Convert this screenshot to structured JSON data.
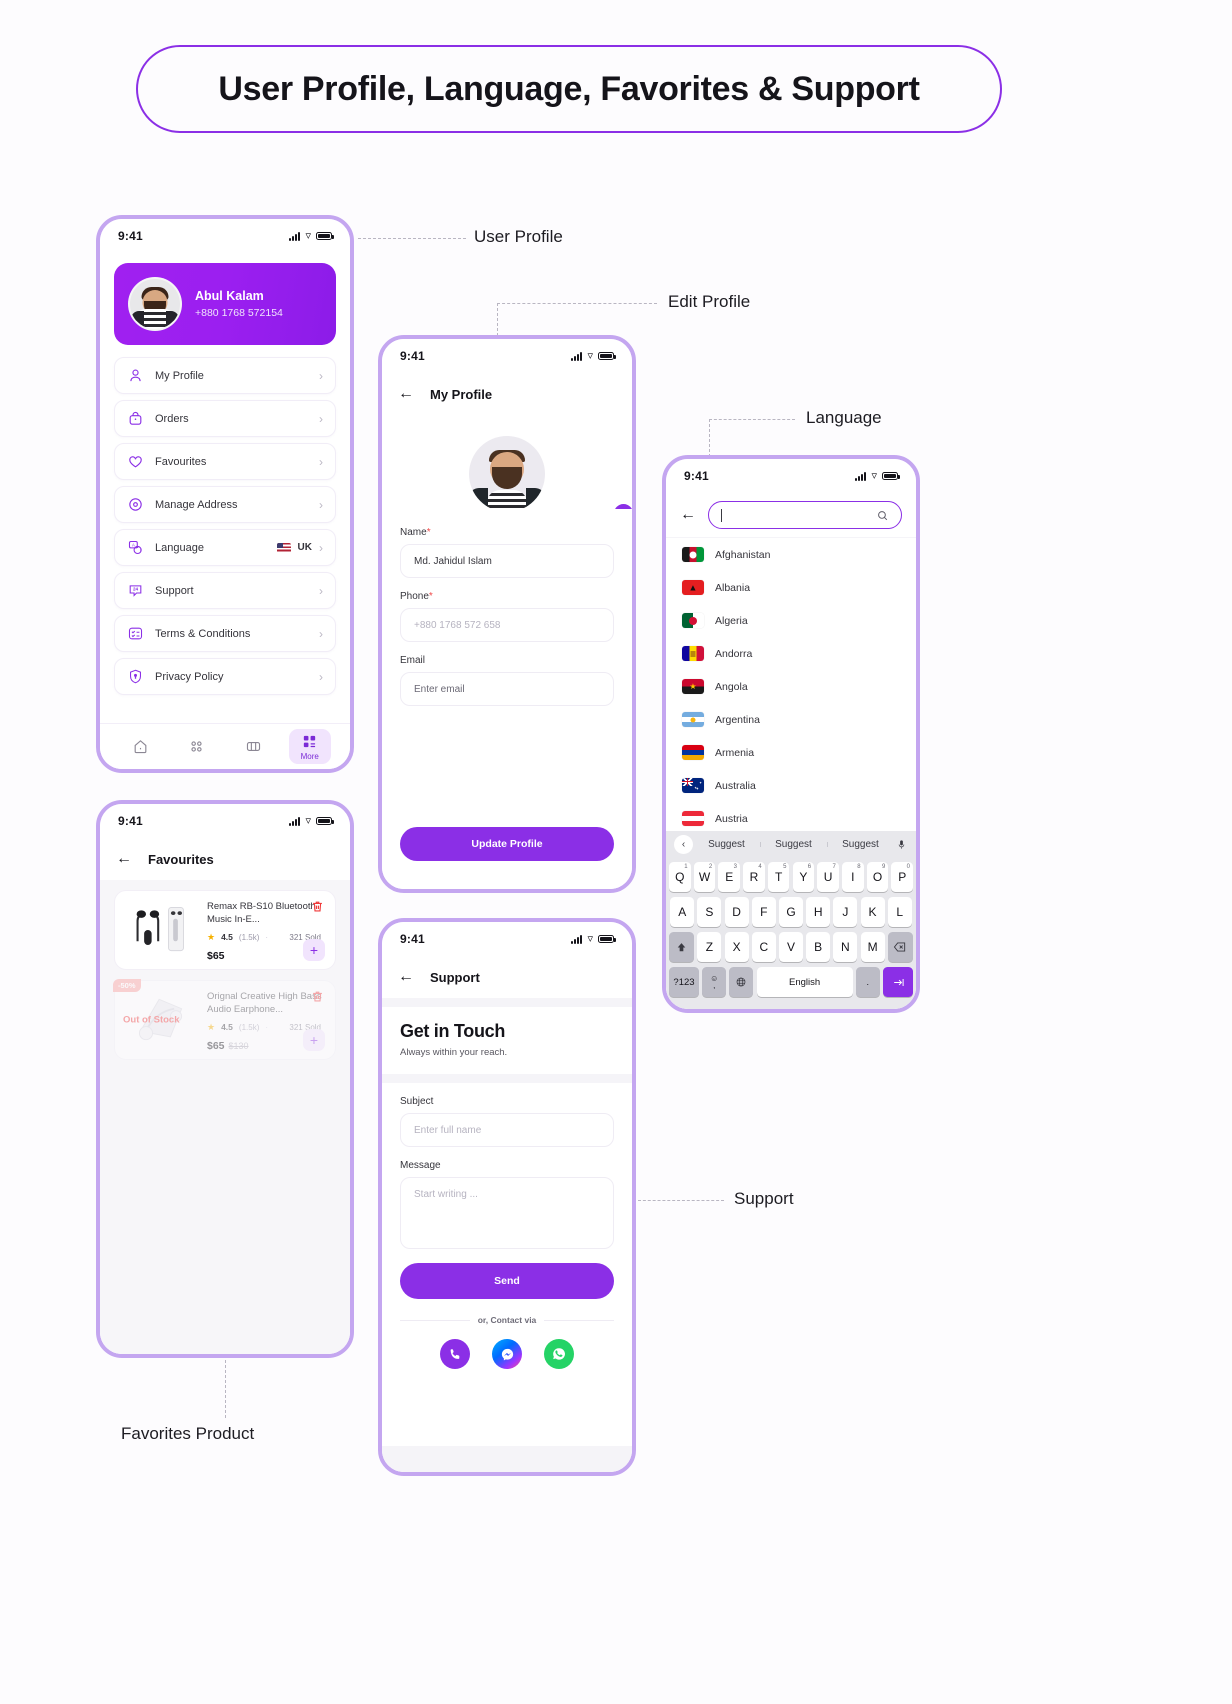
{
  "banner": {
    "title": "User Profile, Language, Favorites & Support"
  },
  "annotations": {
    "user_profile": "User Profile",
    "edit_profile": "Edit Profile",
    "language": "Language",
    "support": "Support",
    "favorites_product": "Favorites Product"
  },
  "status_bar": {
    "time": "9:41"
  },
  "profile_screen": {
    "user": {
      "name": "Abul Kalam",
      "phone": "+880 1768 572154"
    },
    "menu": [
      {
        "label": "My Profile",
        "icon": "user-icon",
        "value": ""
      },
      {
        "label": "Orders",
        "icon": "bag-icon",
        "value": ""
      },
      {
        "label": "Favourites",
        "icon": "heart-icon",
        "value": ""
      },
      {
        "label": "Manage Address",
        "icon": "location-icon",
        "value": ""
      },
      {
        "label": "Language",
        "icon": "translate-icon",
        "value": "UK"
      },
      {
        "label": "Support",
        "icon": "support-24-icon",
        "value": ""
      },
      {
        "label": "Terms & Conditions",
        "icon": "list-check-icon",
        "value": ""
      },
      {
        "label": "Privacy Policy",
        "icon": "shield-icon",
        "value": ""
      }
    ],
    "tabs": [
      {
        "label": "",
        "icon": "home-icon",
        "active": false
      },
      {
        "label": "",
        "icon": "category-icon",
        "active": false
      },
      {
        "label": "",
        "icon": "wallet-icon",
        "active": false
      },
      {
        "label": "More",
        "icon": "grid-icon",
        "active": true
      }
    ]
  },
  "favourites_screen": {
    "title": "Favourites",
    "items": [
      {
        "name": "Remax RB-S10 Bluetooth Music In-E...",
        "rating": "4.5",
        "rating_count": "(1.5k)",
        "sold": "321 Sold",
        "price": "$65",
        "old_price": "",
        "discount": "",
        "out_of_stock": false,
        "image": "earphones-image"
      },
      {
        "name": "Orignal Creative High Bass Audio Earphone...",
        "rating": "4.5",
        "rating_count": "(1.5k)",
        "sold": "321 Sold",
        "price": "$65",
        "old_price": "$130",
        "discount": "-50%",
        "out_of_stock": true,
        "out_of_stock_label": "Out of Stock",
        "image": "headphone-image"
      }
    ]
  },
  "edit_profile_screen": {
    "title": "My Profile",
    "fields": [
      {
        "label": "Name",
        "required": true,
        "value": "Md. Jahidul Islam",
        "placeholder": ""
      },
      {
        "label": "Phone",
        "required": true,
        "value": "",
        "placeholder": "+880 1768 572 658"
      },
      {
        "label": "Email",
        "required": false,
        "value": "",
        "placeholder": "Enter email"
      }
    ],
    "submit_label": "Update Profile"
  },
  "support_screen": {
    "title": "Support",
    "heading": "Get in Touch",
    "subheading": "Always within your reach.",
    "fields": [
      {
        "label": "Subject",
        "placeholder": "Enter full name"
      },
      {
        "label": "Message",
        "placeholder": "Start writing ..."
      }
    ],
    "submit_label": "Send",
    "contact_divider": "or, Contact via",
    "contacts": [
      {
        "name": "phone-icon"
      },
      {
        "name": "messenger-icon"
      },
      {
        "name": "whatsapp-icon"
      }
    ]
  },
  "language_screen": {
    "search_value": "",
    "countries": [
      {
        "name": "Afghanistan",
        "flag": "af"
      },
      {
        "name": "Albania",
        "flag": "al"
      },
      {
        "name": "Algeria",
        "flag": "dz"
      },
      {
        "name": "Andorra",
        "flag": "ad"
      },
      {
        "name": "Angola",
        "flag": "ao"
      },
      {
        "name": "Argentina",
        "flag": "ar"
      },
      {
        "name": "Armenia",
        "flag": "am"
      },
      {
        "name": "Australia",
        "flag": "au"
      },
      {
        "name": "Austria",
        "flag": "at"
      }
    ],
    "keyboard": {
      "suggestions": [
        "Suggest",
        "Suggest",
        "Suggest"
      ],
      "row1": [
        {
          "k": "Q",
          "n": "1"
        },
        {
          "k": "W",
          "n": "2"
        },
        {
          "k": "E",
          "n": "3"
        },
        {
          "k": "R",
          "n": "4"
        },
        {
          "k": "T",
          "n": "5"
        },
        {
          "k": "Y",
          "n": "6"
        },
        {
          "k": "U",
          "n": "7"
        },
        {
          "k": "I",
          "n": "8"
        },
        {
          "k": "O",
          "n": "9"
        },
        {
          "k": "P",
          "n": "0"
        }
      ],
      "row2": [
        "A",
        "S",
        "D",
        "F",
        "G",
        "H",
        "J",
        "K",
        "L"
      ],
      "row3": [
        "Z",
        "X",
        "C",
        "V",
        "B",
        "N",
        "M"
      ],
      "num_key": "?123",
      "emoji_key": "☺",
      "comma_key": ",",
      "globe_key": "globe-icon",
      "space_key": "English",
      "period_key": ".",
      "shift_key": "shift-icon",
      "backspace_key": "backspace-icon",
      "enter_key": "enter-icon"
    }
  },
  "colors": {
    "accent": "#8b2fe6",
    "accent_light": "#c4a6f0",
    "danger": "#f03a3a",
    "star": "#f6b100",
    "whatsapp": "#25d366"
  }
}
